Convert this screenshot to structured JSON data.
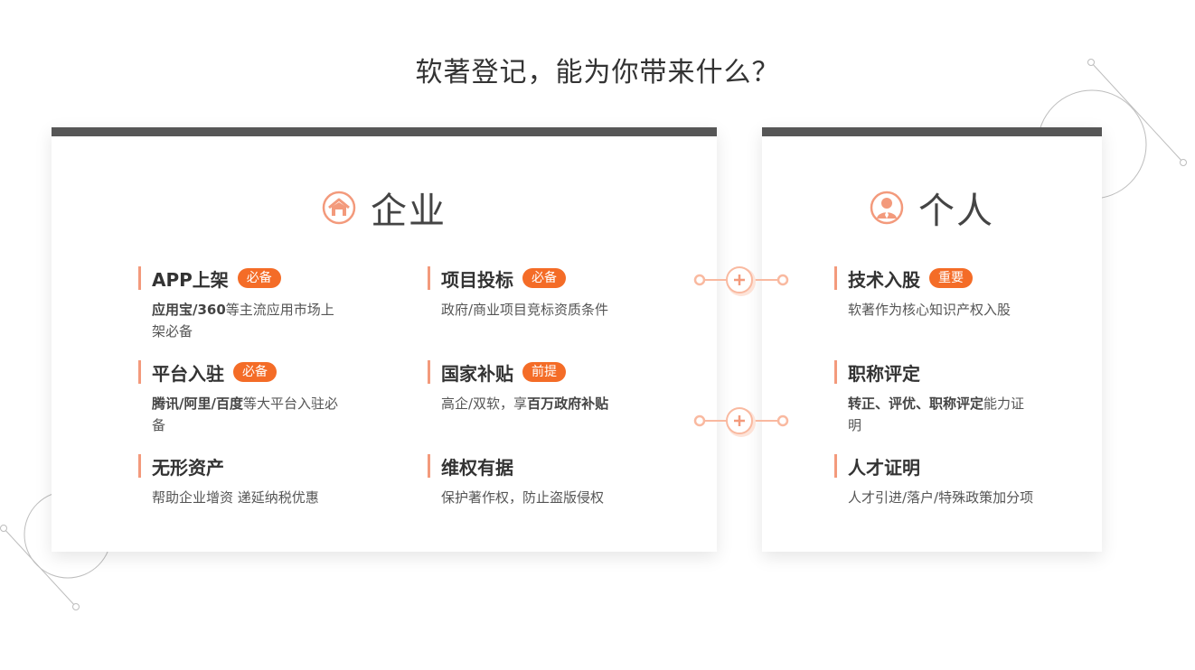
{
  "page": {
    "title": "软著登记，能为你带来什么？"
  },
  "colors": {
    "accent": "#f46c27",
    "bar": "#565656",
    "icon": "#f39a7c"
  },
  "enterprise": {
    "title": "企业",
    "icon": "house-icon",
    "items": [
      {
        "title": "APP上架",
        "badge": "必备",
        "desc_bold": "应用宝/360",
        "desc_rest": "等主流应用市场上架必备"
      },
      {
        "title": "项目投标",
        "badge": "必备",
        "desc_bold": "",
        "desc_rest": "政府/商业项目竞标资质条件"
      },
      {
        "title": "平台入驻",
        "badge": "必备",
        "desc_bold": "腾讯/阿里/百度",
        "desc_rest": "等大平台入驻必备"
      },
      {
        "title": "国家补贴",
        "badge": "前提",
        "desc_rest": "高企/双软，享",
        "desc_bold": "百万政府补贴"
      },
      {
        "title": "无形资产",
        "badge": "",
        "desc_bold": "",
        "desc_rest": "帮助企业增资 递延纳税优惠"
      },
      {
        "title": "维权有据",
        "badge": "",
        "desc_bold": "",
        "desc_rest": "保护著作权，防止盗版侵权"
      }
    ]
  },
  "personal": {
    "title": "个人",
    "icon": "person-icon",
    "items": [
      {
        "title": "技术入股",
        "badge": "重要",
        "desc_bold": "",
        "desc_rest": "软著作为核心知识产权入股"
      },
      {
        "title": "职称评定",
        "badge": "",
        "desc_bold": "转正、评优、职称评定",
        "desc_rest": "能力证明"
      },
      {
        "title": "人才证明",
        "badge": "",
        "desc_bold": "",
        "desc_rest": "人才引进/落户/特殊政策加分项"
      }
    ]
  },
  "connectors": {
    "icon": "plus-icon"
  }
}
